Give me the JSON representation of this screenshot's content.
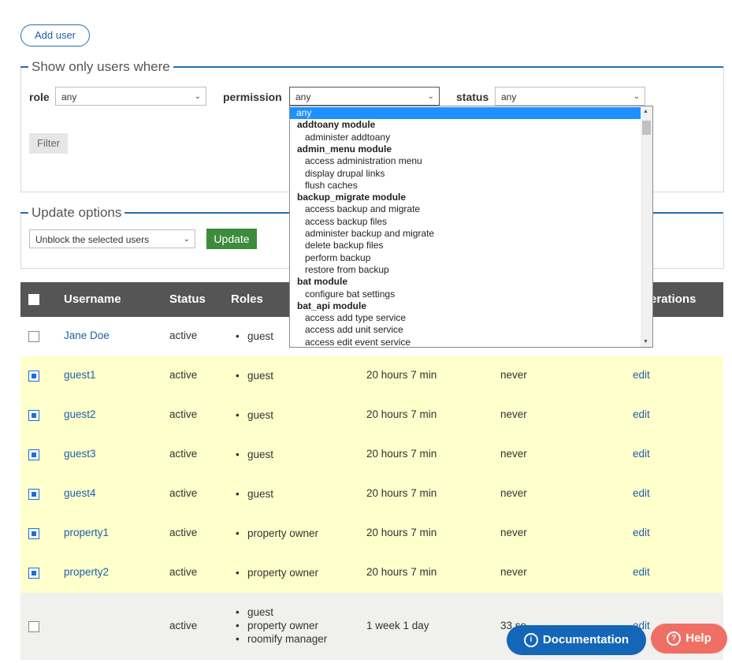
{
  "add_user_label": "Add user",
  "filter_section": {
    "legend": "Show only users where",
    "role_label": "role",
    "role_value": "any",
    "permission_label": "permission",
    "permission_value": "any",
    "status_label": "status",
    "status_value": "any",
    "filter_button": "Filter"
  },
  "permission_dropdown": {
    "items": [
      {
        "kind": "selected",
        "text": "any"
      },
      {
        "kind": "group",
        "text": "addtoany module"
      },
      {
        "kind": "option",
        "text": "administer addtoany"
      },
      {
        "kind": "group",
        "text": "admin_menu module"
      },
      {
        "kind": "option",
        "text": "access administration menu"
      },
      {
        "kind": "option",
        "text": "display drupal links"
      },
      {
        "kind": "option",
        "text": "flush caches"
      },
      {
        "kind": "group",
        "text": "backup_migrate module"
      },
      {
        "kind": "option",
        "text": "access backup and migrate"
      },
      {
        "kind": "option",
        "text": "access backup files"
      },
      {
        "kind": "option",
        "text": "administer backup and migrate"
      },
      {
        "kind": "option",
        "text": "delete backup files"
      },
      {
        "kind": "option",
        "text": "perform backup"
      },
      {
        "kind": "option",
        "text": "restore from backup"
      },
      {
        "kind": "group",
        "text": "bat module"
      },
      {
        "kind": "option",
        "text": "configure bat settings"
      },
      {
        "kind": "group",
        "text": "bat_api module"
      },
      {
        "kind": "option",
        "text": "access add type service"
      },
      {
        "kind": "option",
        "text": "access add unit service"
      },
      {
        "kind": "option",
        "text": "access edit event service"
      }
    ]
  },
  "update_section": {
    "legend": "Update options",
    "action_value": "Unblock the selected users",
    "update_button": "Update"
  },
  "table": {
    "headers": {
      "username": "Username",
      "status": "Status",
      "roles": "Roles",
      "operations": "erations"
    },
    "rows": [
      {
        "checked": false,
        "username": "Jane Doe",
        "status": "active",
        "roles": [
          "guest"
        ],
        "member_for": "",
        "last_access": "",
        "op": "",
        "highlight": false
      },
      {
        "checked": true,
        "username": "guest1",
        "status": "active",
        "roles": [
          "guest"
        ],
        "member_for": "20 hours 7 min",
        "last_access": "never",
        "op": "edit",
        "highlight": true
      },
      {
        "checked": true,
        "username": "guest2",
        "status": "active",
        "roles": [
          "guest"
        ],
        "member_for": "20 hours 7 min",
        "last_access": "never",
        "op": "edit",
        "highlight": true
      },
      {
        "checked": true,
        "username": "guest3",
        "status": "active",
        "roles": [
          "guest"
        ],
        "member_for": "20 hours 7 min",
        "last_access": "never",
        "op": "edit",
        "highlight": true
      },
      {
        "checked": true,
        "username": "guest4",
        "status": "active",
        "roles": [
          "guest"
        ],
        "member_for": "20 hours 7 min",
        "last_access": "never",
        "op": "edit",
        "highlight": true
      },
      {
        "checked": true,
        "username": "property1",
        "status": "active",
        "roles": [
          "property owner"
        ],
        "member_for": "20 hours 7 min",
        "last_access": "never",
        "op": "edit",
        "highlight": true
      },
      {
        "checked": true,
        "username": "property2",
        "status": "active",
        "roles": [
          "property owner"
        ],
        "member_for": "20 hours 7 min",
        "last_access": "never",
        "op": "edit",
        "highlight": true
      },
      {
        "checked": false,
        "username": "",
        "status": "active",
        "roles": [
          "guest",
          "property owner",
          "roomify manager"
        ],
        "member_for": "1 week 1 day",
        "last_access": "33 sec ago",
        "op": "edit",
        "highlight": false
      }
    ]
  },
  "floating": {
    "documentation": "Documentation",
    "help": "Help"
  },
  "colors": {
    "accent": "#1f5fa8",
    "highlight_row": "#ffffcc",
    "header_bg": "#555555",
    "update_green": "#3d8b3d",
    "help_red": "#ef6f64"
  }
}
